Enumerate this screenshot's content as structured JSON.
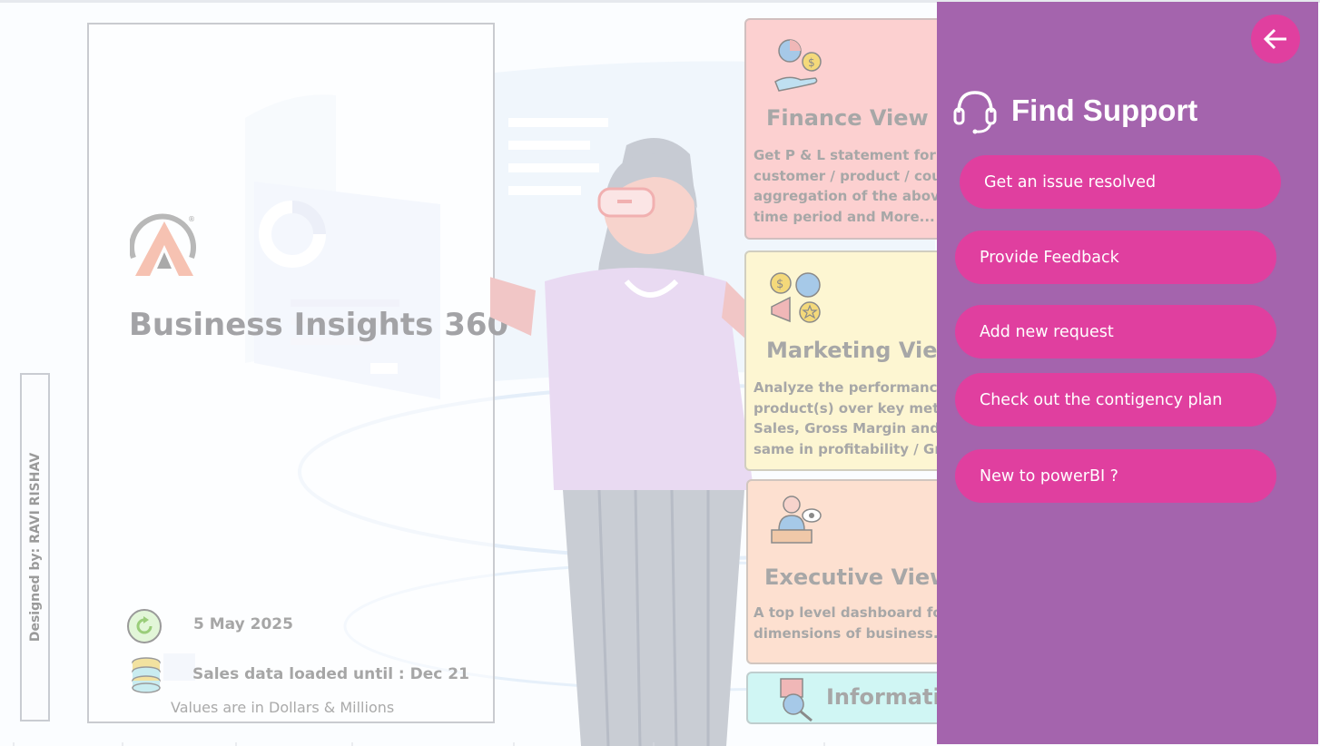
{
  "designer": "Designed by: RAVI RISHAV",
  "title_card": {
    "logo": "atliq-logo",
    "title": "Business Insights 360",
    "refresh_date": "5 May 2025",
    "data_loaded": "Sales data loaded until : Dec 21",
    "values_note": "Values are in Dollars & Millions"
  },
  "views": {
    "finance": {
      "title": "Finance View",
      "description": [
        "Get P & L statement for ar",
        "customer / product / coun",
        "aggregation of the above",
        "time period and More..."
      ],
      "icon": "finance-hand-coin-icon",
      "color": "#fcd0d0"
    },
    "marketing": {
      "title": "Marketing View",
      "description": [
        "Analyze the performance",
        "product(s) over key metric",
        "Sales, Gross Margin and v",
        "same in profitability / Gro"
      ],
      "icon": "marketing-megaphone-icon",
      "color": "#fdf6d2"
    },
    "executive": {
      "title": "Executive View",
      "description": [
        "A top level dashboard for",
        "dimensions of business."
      ],
      "icon": "executive-presenter-icon",
      "color": "#fde0d0"
    },
    "information": {
      "title": "Informati",
      "icon": "information-search-icon",
      "color": "#d0f6f4"
    }
  },
  "support_panel": {
    "title": "Find Support",
    "back_icon": "arrow-left-icon",
    "support_icon": "headset-icon",
    "panel_color": "#a464ad",
    "button_color": "#e03f9f",
    "buttons": [
      "Get an issue resolved",
      "Provide Feedback",
      "Add new request",
      "Check out the contigency plan",
      "New to powerBI ?"
    ]
  }
}
